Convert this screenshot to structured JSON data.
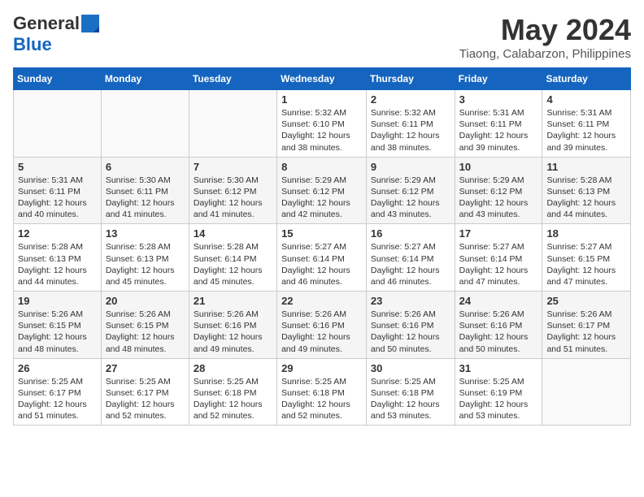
{
  "header": {
    "logo_general": "General",
    "logo_blue": "Blue",
    "title": "May 2024",
    "subtitle": "Tiaong, Calabarzon, Philippines"
  },
  "days_of_week": [
    "Sunday",
    "Monday",
    "Tuesday",
    "Wednesday",
    "Thursday",
    "Friday",
    "Saturday"
  ],
  "weeks": [
    [
      {
        "day": "",
        "info": ""
      },
      {
        "day": "",
        "info": ""
      },
      {
        "day": "",
        "info": ""
      },
      {
        "day": "1",
        "info": "Sunrise: 5:32 AM\nSunset: 6:10 PM\nDaylight: 12 hours and 38 minutes."
      },
      {
        "day": "2",
        "info": "Sunrise: 5:32 AM\nSunset: 6:11 PM\nDaylight: 12 hours and 38 minutes."
      },
      {
        "day": "3",
        "info": "Sunrise: 5:31 AM\nSunset: 6:11 PM\nDaylight: 12 hours and 39 minutes."
      },
      {
        "day": "4",
        "info": "Sunrise: 5:31 AM\nSunset: 6:11 PM\nDaylight: 12 hours and 39 minutes."
      }
    ],
    [
      {
        "day": "5",
        "info": "Sunrise: 5:31 AM\nSunset: 6:11 PM\nDaylight: 12 hours and 40 minutes."
      },
      {
        "day": "6",
        "info": "Sunrise: 5:30 AM\nSunset: 6:11 PM\nDaylight: 12 hours and 41 minutes."
      },
      {
        "day": "7",
        "info": "Sunrise: 5:30 AM\nSunset: 6:12 PM\nDaylight: 12 hours and 41 minutes."
      },
      {
        "day": "8",
        "info": "Sunrise: 5:29 AM\nSunset: 6:12 PM\nDaylight: 12 hours and 42 minutes."
      },
      {
        "day": "9",
        "info": "Sunrise: 5:29 AM\nSunset: 6:12 PM\nDaylight: 12 hours and 43 minutes."
      },
      {
        "day": "10",
        "info": "Sunrise: 5:29 AM\nSunset: 6:12 PM\nDaylight: 12 hours and 43 minutes."
      },
      {
        "day": "11",
        "info": "Sunrise: 5:28 AM\nSunset: 6:13 PM\nDaylight: 12 hours and 44 minutes."
      }
    ],
    [
      {
        "day": "12",
        "info": "Sunrise: 5:28 AM\nSunset: 6:13 PM\nDaylight: 12 hours and 44 minutes."
      },
      {
        "day": "13",
        "info": "Sunrise: 5:28 AM\nSunset: 6:13 PM\nDaylight: 12 hours and 45 minutes."
      },
      {
        "day": "14",
        "info": "Sunrise: 5:28 AM\nSunset: 6:14 PM\nDaylight: 12 hours and 45 minutes."
      },
      {
        "day": "15",
        "info": "Sunrise: 5:27 AM\nSunset: 6:14 PM\nDaylight: 12 hours and 46 minutes."
      },
      {
        "day": "16",
        "info": "Sunrise: 5:27 AM\nSunset: 6:14 PM\nDaylight: 12 hours and 46 minutes."
      },
      {
        "day": "17",
        "info": "Sunrise: 5:27 AM\nSunset: 6:14 PM\nDaylight: 12 hours and 47 minutes."
      },
      {
        "day": "18",
        "info": "Sunrise: 5:27 AM\nSunset: 6:15 PM\nDaylight: 12 hours and 47 minutes."
      }
    ],
    [
      {
        "day": "19",
        "info": "Sunrise: 5:26 AM\nSunset: 6:15 PM\nDaylight: 12 hours and 48 minutes."
      },
      {
        "day": "20",
        "info": "Sunrise: 5:26 AM\nSunset: 6:15 PM\nDaylight: 12 hours and 48 minutes."
      },
      {
        "day": "21",
        "info": "Sunrise: 5:26 AM\nSunset: 6:16 PM\nDaylight: 12 hours and 49 minutes."
      },
      {
        "day": "22",
        "info": "Sunrise: 5:26 AM\nSunset: 6:16 PM\nDaylight: 12 hours and 49 minutes."
      },
      {
        "day": "23",
        "info": "Sunrise: 5:26 AM\nSunset: 6:16 PM\nDaylight: 12 hours and 50 minutes."
      },
      {
        "day": "24",
        "info": "Sunrise: 5:26 AM\nSunset: 6:16 PM\nDaylight: 12 hours and 50 minutes."
      },
      {
        "day": "25",
        "info": "Sunrise: 5:26 AM\nSunset: 6:17 PM\nDaylight: 12 hours and 51 minutes."
      }
    ],
    [
      {
        "day": "26",
        "info": "Sunrise: 5:25 AM\nSunset: 6:17 PM\nDaylight: 12 hours and 51 minutes."
      },
      {
        "day": "27",
        "info": "Sunrise: 5:25 AM\nSunset: 6:17 PM\nDaylight: 12 hours and 52 minutes."
      },
      {
        "day": "28",
        "info": "Sunrise: 5:25 AM\nSunset: 6:18 PM\nDaylight: 12 hours and 52 minutes."
      },
      {
        "day": "29",
        "info": "Sunrise: 5:25 AM\nSunset: 6:18 PM\nDaylight: 12 hours and 52 minutes."
      },
      {
        "day": "30",
        "info": "Sunrise: 5:25 AM\nSunset: 6:18 PM\nDaylight: 12 hours and 53 minutes."
      },
      {
        "day": "31",
        "info": "Sunrise: 5:25 AM\nSunset: 6:19 PM\nDaylight: 12 hours and 53 minutes."
      },
      {
        "day": "",
        "info": ""
      }
    ]
  ]
}
